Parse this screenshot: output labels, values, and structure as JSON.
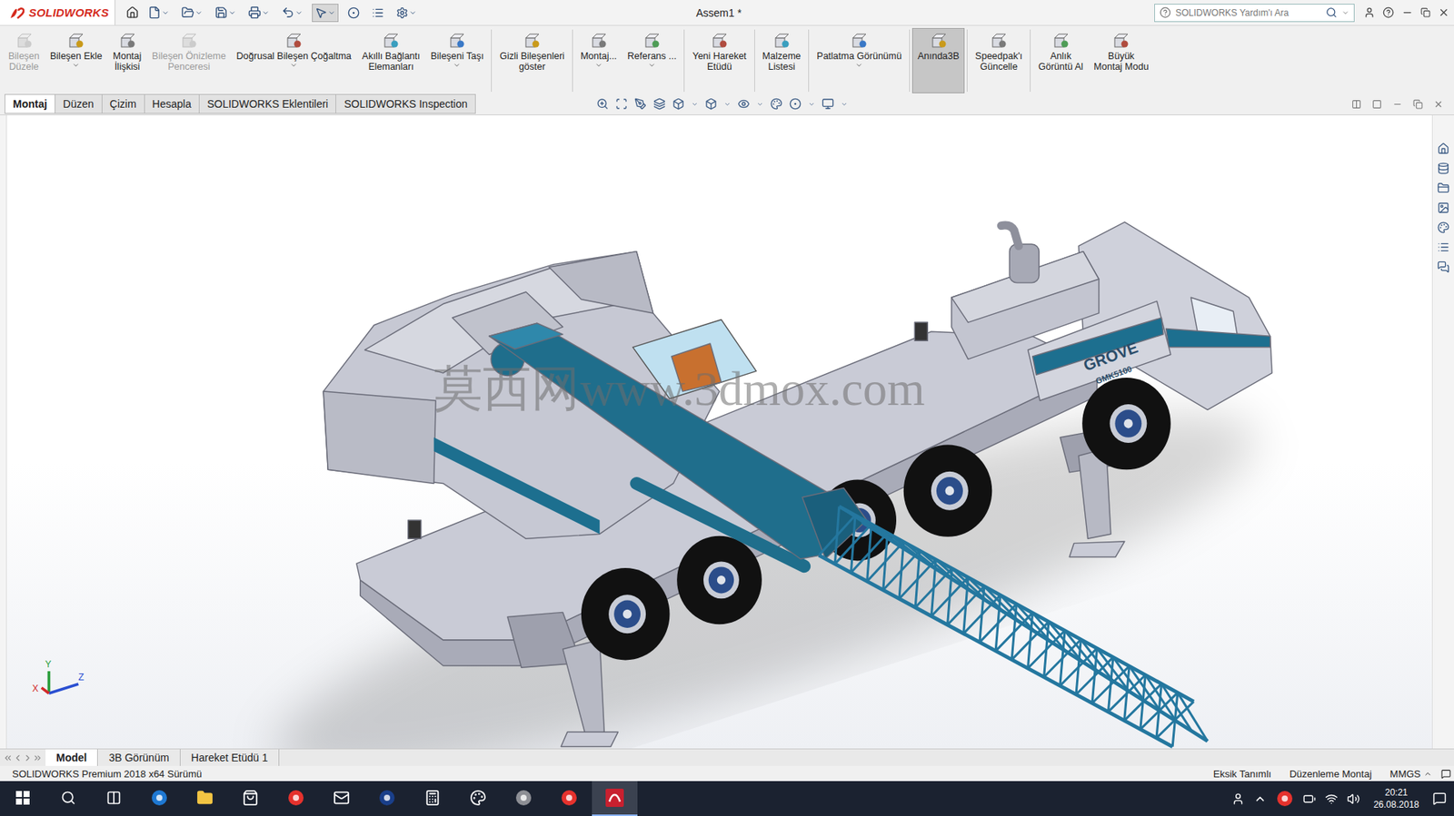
{
  "app": {
    "logo": "SOLIDWORKS",
    "title": "Assem1 *",
    "search_placeholder": "SOLIDWORKS Yardım'ı Ara"
  },
  "ribbon": [
    {
      "lines": [
        "Bileşen",
        "Düzele"
      ],
      "disabled": true,
      "selected": false,
      "dropdown": false,
      "separator_before": false
    },
    {
      "lines": [
        "Bileşen Ekle"
      ],
      "disabled": false,
      "selected": false,
      "dropdown": true,
      "separator_before": false
    },
    {
      "lines": [
        "Montaj",
        "İlişkisi"
      ],
      "disabled": false,
      "selected": false,
      "dropdown": false,
      "separator_before": false
    },
    {
      "lines": [
        "Bileşen Önizleme",
        "Penceresi"
      ],
      "disabled": true,
      "selected": false,
      "dropdown": false,
      "separator_before": false
    },
    {
      "lines": [
        "Doğrusal Bileşen Çoğaltma"
      ],
      "disabled": false,
      "selected": false,
      "dropdown": true,
      "separator_before": false
    },
    {
      "lines": [
        "Akıllı Bağlantı",
        "Elemanları"
      ],
      "disabled": false,
      "selected": false,
      "dropdown": false,
      "separator_before": false
    },
    {
      "lines": [
        "Bileşeni Taşı"
      ],
      "disabled": false,
      "selected": false,
      "dropdown": true,
      "separator_before": false
    },
    {
      "lines": [
        "Gizli Bileşenleri",
        "göster"
      ],
      "disabled": false,
      "selected": false,
      "dropdown": false,
      "separator_before": true
    },
    {
      "lines": [
        "Montaj..."
      ],
      "disabled": false,
      "selected": false,
      "dropdown": true,
      "separator_before": true
    },
    {
      "lines": [
        "Referans ..."
      ],
      "disabled": false,
      "selected": false,
      "dropdown": true,
      "separator_before": false
    },
    {
      "lines": [
        "Yeni Hareket",
        "Etüdü"
      ],
      "disabled": false,
      "selected": false,
      "dropdown": false,
      "separator_before": true
    },
    {
      "lines": [
        "Malzeme",
        "Listesi"
      ],
      "disabled": false,
      "selected": false,
      "dropdown": false,
      "separator_before": true
    },
    {
      "lines": [
        "Patlatma Görünümü"
      ],
      "disabled": false,
      "selected": false,
      "dropdown": true,
      "separator_before": true
    },
    {
      "lines": [
        "Anında3B"
      ],
      "disabled": false,
      "selected": true,
      "dropdown": false,
      "separator_before": true
    },
    {
      "lines": [
        "Speedpak'ı",
        "Güncelle"
      ],
      "disabled": false,
      "selected": false,
      "dropdown": false,
      "separator_before": true
    },
    {
      "lines": [
        "Anlık",
        "Görüntü Al"
      ],
      "disabled": false,
      "selected": false,
      "dropdown": false,
      "separator_before": true
    },
    {
      "lines": [
        "Büyük",
        "Montaj Modu"
      ],
      "disabled": false,
      "selected": false,
      "dropdown": false,
      "separator_before": false
    }
  ],
  "tabs": [
    {
      "label": "Montaj",
      "selected": true
    },
    {
      "label": "Düzen",
      "selected": false
    },
    {
      "label": "Çizim",
      "selected": false
    },
    {
      "label": "Hesapla",
      "selected": false
    },
    {
      "label": "SOLIDWORKS Eklentileri",
      "selected": false
    },
    {
      "label": "SOLIDWORKS Inspection",
      "selected": false
    }
  ],
  "viewport": {
    "watermark": "莫西网www.3dmox.com",
    "model_labels": [
      "GROVE",
      "GMK5100"
    ],
    "axes": [
      "X",
      "Y",
      "Z"
    ]
  },
  "bottom_tabs": [
    {
      "label": "Model",
      "selected": true
    },
    {
      "label": "3B Görünüm",
      "selected": false
    },
    {
      "label": "Hareket Etüdü 1",
      "selected": false
    }
  ],
  "status_bar": {
    "version": "SOLIDWORKS Premium 2018 x64 Sürümü",
    "items": [
      "Eksik Tanımlı",
      "Düzenleme Montaj",
      "MMGS"
    ]
  },
  "taskbar": {
    "time": "20:21",
    "date": "26.08.2018"
  }
}
